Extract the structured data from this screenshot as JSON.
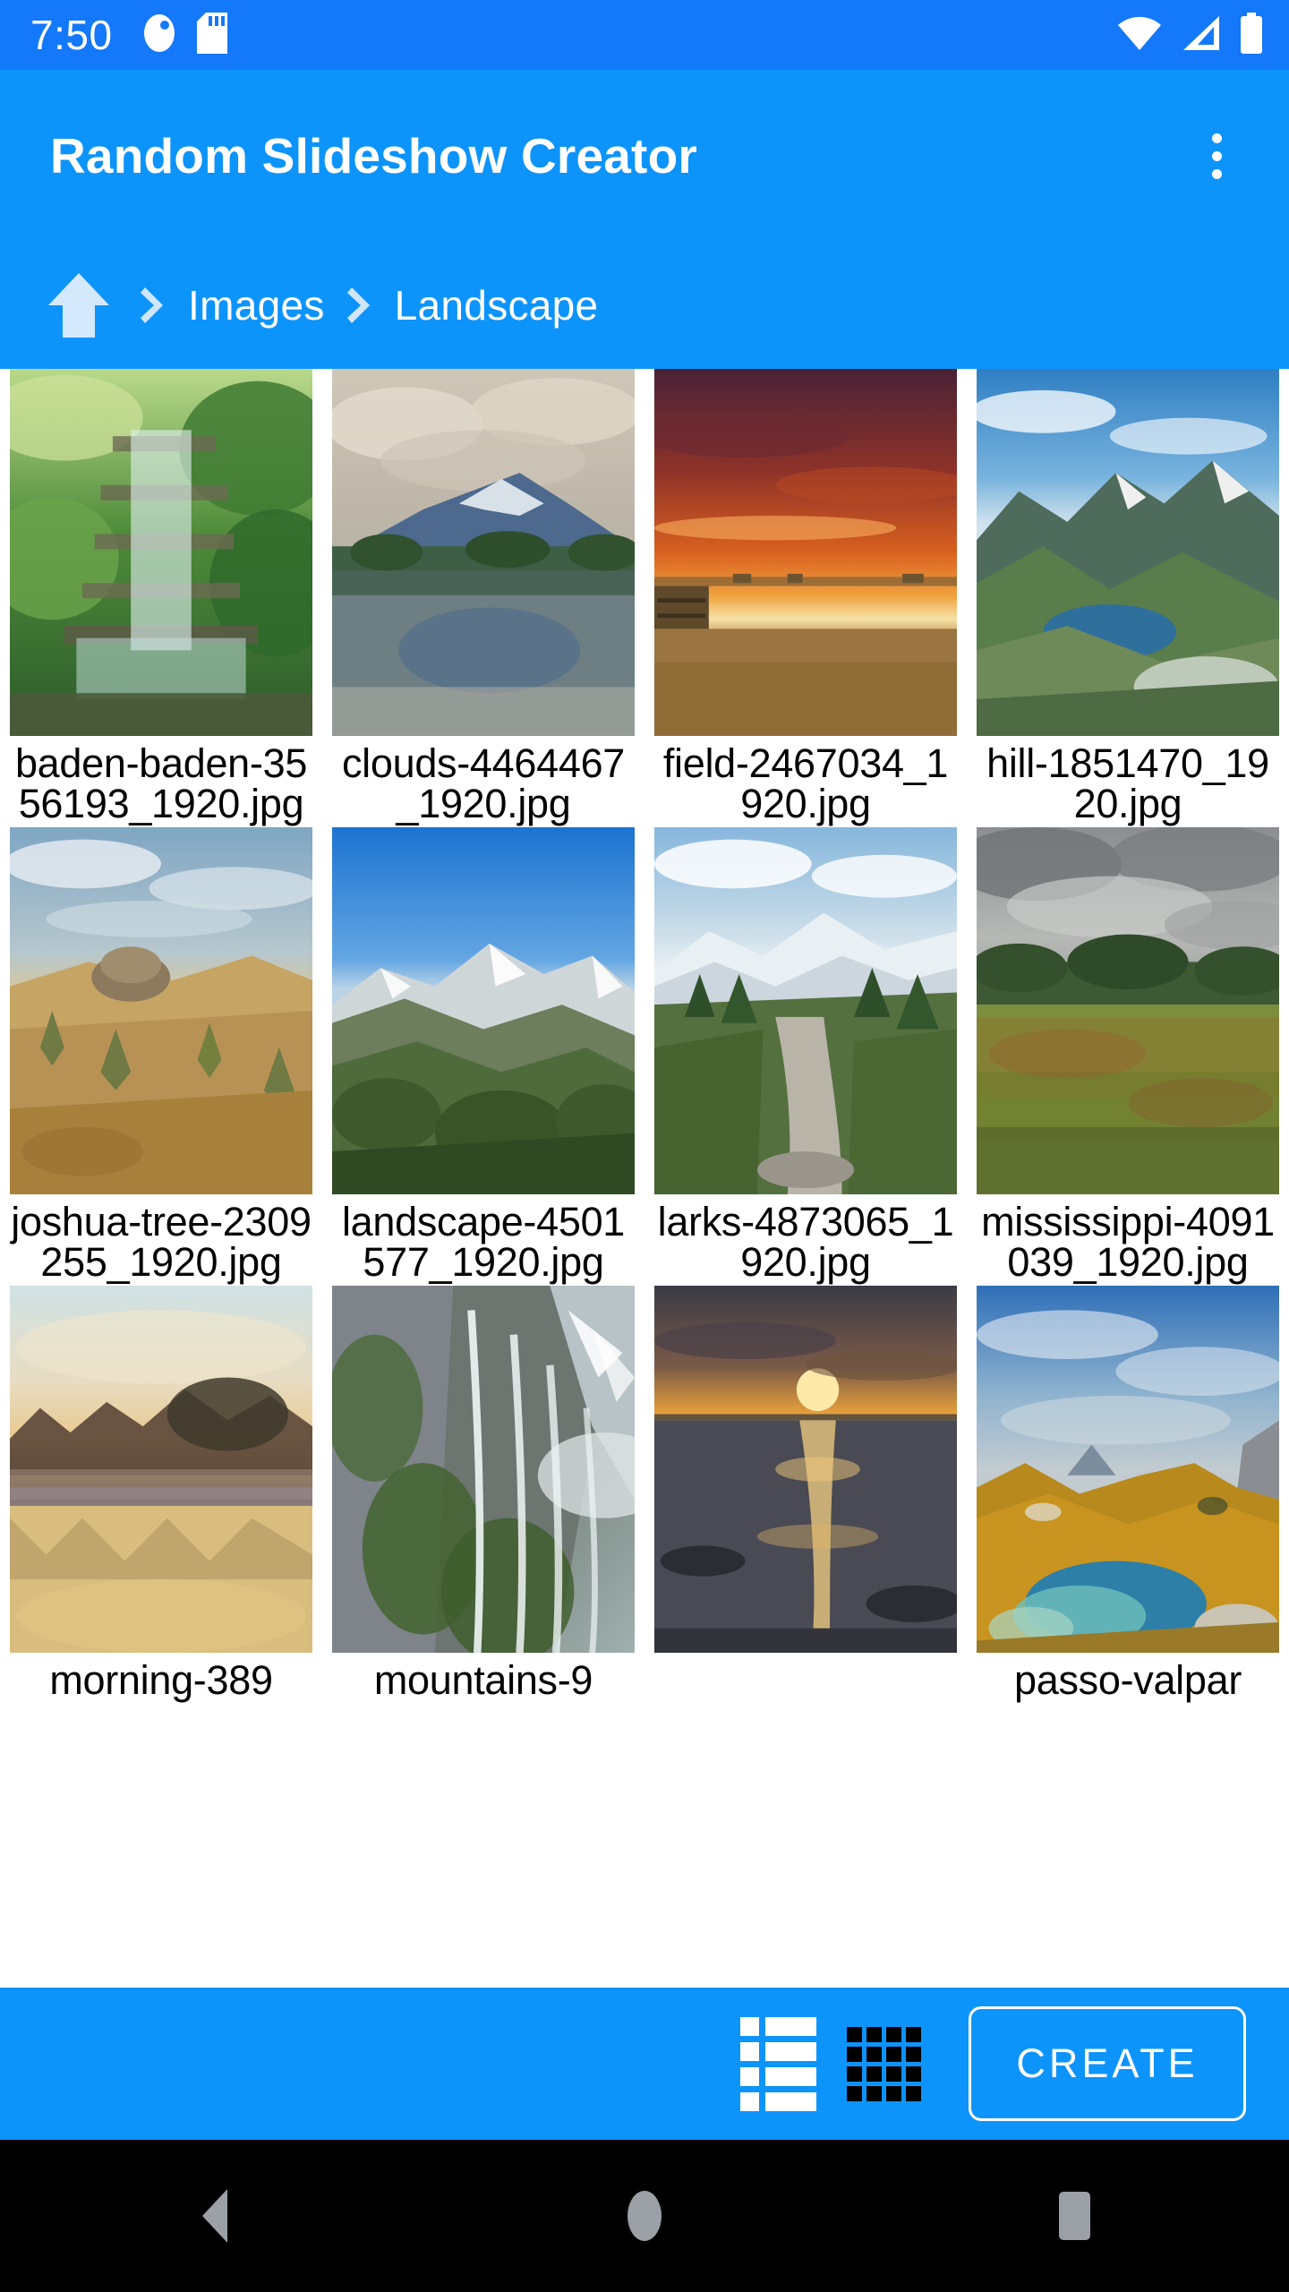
{
  "status_bar": {
    "time": "7:50",
    "left_icons": [
      "contact-photo-icon",
      "sd-card-icon"
    ],
    "right_icons": [
      "wifi-icon",
      "cell-signal-icon",
      "battery-icon"
    ],
    "background": "#1478fa"
  },
  "app_bar": {
    "title": "Random Slideshow Creator",
    "overflow_icon": "more-vert-icon",
    "background": "#0d94fb"
  },
  "breadcrumb": {
    "home_icon": "home-icon",
    "separator": "chevron-right-icon",
    "items": [
      {
        "label": "Images"
      },
      {
        "label": "Landscape"
      }
    ]
  },
  "gallery": {
    "columns": 4,
    "items": [
      {
        "name": "baden-baden-3556193_1920.jpg",
        "thumb": "waterfall-garden"
      },
      {
        "name": "clouds-4464467_1920.jpg",
        "thumb": "cloudy-lake-mountain"
      },
      {
        "name": "field-2467034_1920.jpg",
        "thumb": "sunset-hay-field"
      },
      {
        "name": "hill-1851470_1920.jpg",
        "thumb": "alpine-valley-lake"
      },
      {
        "name": "joshua-tree-2309255_1920.jpg",
        "thumb": "desert-rocks"
      },
      {
        "name": "landscape-4501577_1920.jpg",
        "thumb": "rocky-mountain-range"
      },
      {
        "name": "larks-4873065_1920.jpg",
        "thumb": "snow-mountain-path"
      },
      {
        "name": "mississippi-4091039_1920.jpg",
        "thumb": "stormy-meadow"
      },
      {
        "name": "morning-389",
        "thumb": "misty-morning-lake"
      },
      {
        "name": "mountains-9",
        "thumb": "cliff-waterfalls"
      },
      {
        "name": "",
        "thumb": "ocean-sunset"
      },
      {
        "name": "passo-valpar",
        "thumb": "mountain-tarn"
      }
    ]
  },
  "bottom_bar": {
    "list_view_icon": "list-view-icon",
    "grid_view_icon": "grid-view-icon",
    "create_label": "CREATE",
    "background": "#0d94fb"
  },
  "nav_bar": {
    "back": "back-triangle-icon",
    "home": "home-circle-icon",
    "recents": "recents-square-icon",
    "background": "#000000"
  }
}
